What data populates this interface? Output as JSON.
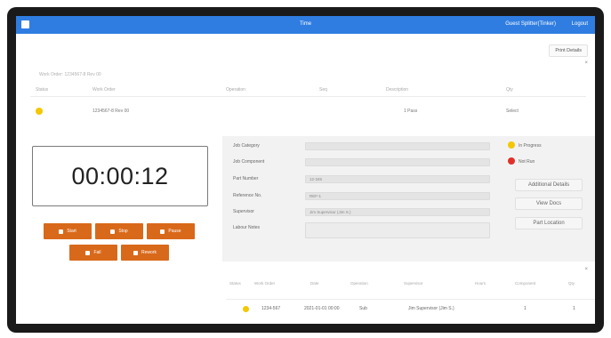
{
  "titlebar": {
    "title": "Time",
    "user": "Guest Splitter(Tinker)",
    "logout": "Logout"
  },
  "page": {
    "print_details": "Print Details",
    "close_symbol": "×",
    "subtitle": "Work Order: 1234567-8 Rev 00"
  },
  "top_table": {
    "headers": [
      "Status",
      "Work Order",
      "Operation",
      "Seq",
      "Description",
      "Qty"
    ],
    "row": {
      "work_order": "1234567-8 Rev 00",
      "operation": "",
      "seq": "",
      "description": "1 Pass",
      "qty": "Select"
    }
  },
  "timer": {
    "value": "00:00:12"
  },
  "action_buttons": [
    {
      "label": "Start",
      "icon": "play-icon"
    },
    {
      "label": "Stop",
      "icon": "stop-icon"
    },
    {
      "label": "Pause",
      "icon": "pause-icon"
    },
    {
      "label": "Fail",
      "icon": "fail-icon"
    },
    {
      "label": "Rework",
      "icon": "rework-icon"
    }
  ],
  "form": {
    "fields": [
      {
        "label": "Job Category",
        "value": ""
      },
      {
        "label": "Job Component",
        "value": ""
      },
      {
        "label": "Part Number",
        "value": "12-345"
      },
      {
        "label": "Reference No.",
        "value": "REF-1"
      },
      {
        "label": "Supervisor",
        "value": "Jim Supervisor (Jim S.)"
      },
      {
        "label": "Labour Notes",
        "value": ""
      }
    ]
  },
  "legend": {
    "in_progress": "In Progress",
    "not_run": "Not Run"
  },
  "side_buttons": {
    "additional_details": "Additional Details",
    "view_docs": "View Docs",
    "part_location": "Part Location"
  },
  "bottom_table": {
    "headers": [
      "Status",
      "Work Order",
      "Operation",
      "Date",
      "Supervisor",
      "Hours",
      "Component",
      "Qty"
    ],
    "row": {
      "work_order": "1234-567",
      "date": "2021-01-01 00:00",
      "operation": "Sub",
      "supervisor": "Jim Supervisor (Jim S.)",
      "hours": "1",
      "qty": "1"
    }
  },
  "colors": {
    "accent": "#2f7de1",
    "button_orange": "#d9691a",
    "in_progress": "#f4c700",
    "not_run": "#e0302a"
  }
}
